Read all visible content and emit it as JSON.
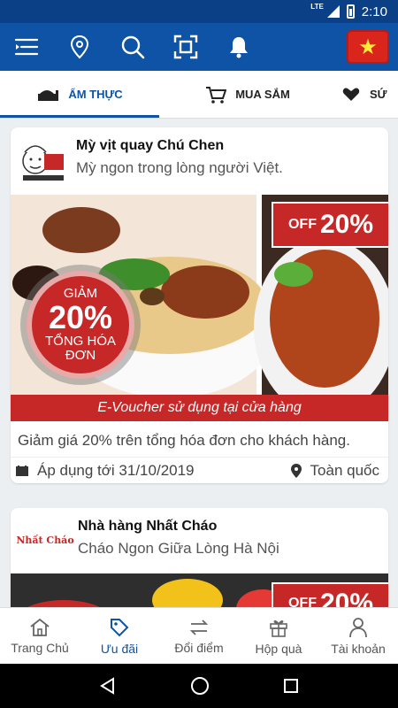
{
  "status_bar": {
    "network": "LTE",
    "time": "2:10"
  },
  "app_bar": {
    "icons": [
      "menu-icon",
      "location-pin-icon",
      "search-icon",
      "qr-scan-icon",
      "bell-icon"
    ],
    "flag": "★"
  },
  "tabs": [
    {
      "label": "ẨM THỰC",
      "icon": "food-icon",
      "active": true
    },
    {
      "label": "MUA SẮM",
      "icon": "cart-icon",
      "active": false
    },
    {
      "label": "SỨ",
      "icon": "heart-hand-icon",
      "active": false
    }
  ],
  "offers": [
    {
      "brand": "Mỳ vịt quay Chú Chen",
      "tagline": "Mỳ ngon trong lòng người Việt.",
      "banner": {
        "off_word": "OFF",
        "off_pct": "20%",
        "circle_top": "GIẢM",
        "circle_mid": "20%",
        "circle_bot": "TỔNG HÓA",
        "circle_bot2": "ĐƠN",
        "strip": "E-Voucher sử dụng tại cửa hàng"
      },
      "description": "Giảm giá 20% trên tổng hóa đơn cho khách hàng.",
      "valid_until": "Áp dụng tới 31/10/2019",
      "scope": "Toàn quốc"
    },
    {
      "brand": "Nhà hàng Nhất Cháo",
      "tagline": "Cháo Ngon Giữa Lòng Hà Nội",
      "logo_text": "Nhất Cháo",
      "banner": {
        "off_word": "OFF",
        "off_pct": "20%"
      }
    }
  ],
  "bottom_nav": [
    {
      "label": "Trang Chủ",
      "icon": "home-icon",
      "active": false
    },
    {
      "label": "Ưu đãi",
      "icon": "tag-icon",
      "active": true
    },
    {
      "label": "Đổi điểm",
      "icon": "exchange-icon",
      "active": false
    },
    {
      "label": "Hộp quà",
      "icon": "gift-icon",
      "active": false
    },
    {
      "label": "Tài khoản",
      "icon": "account-icon",
      "active": false
    }
  ],
  "colors": {
    "primary": "#0e53a5",
    "status": "#0b3f86",
    "accent_red": "#c62828"
  }
}
